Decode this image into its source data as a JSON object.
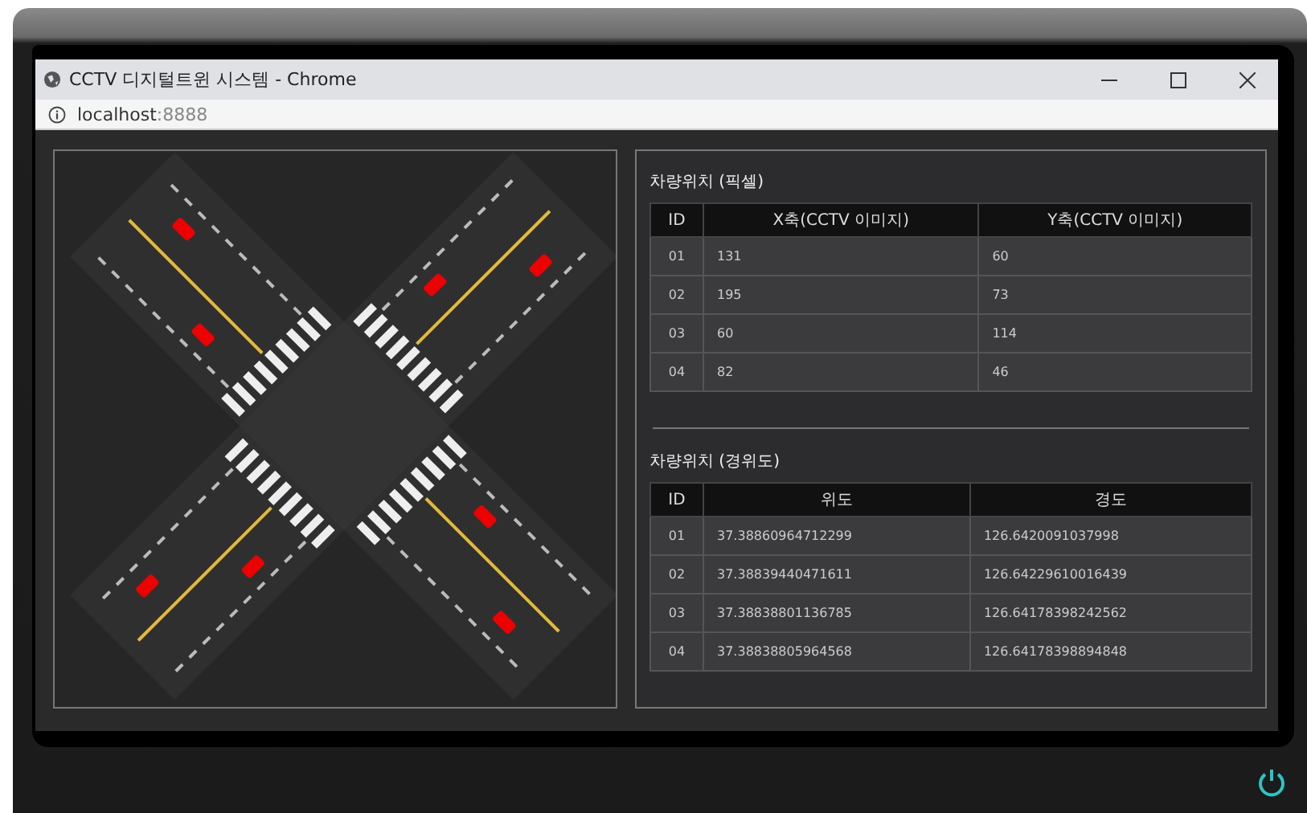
{
  "window": {
    "title": "CCTV 디지털트윈 시스템 - Chrome"
  },
  "address_bar": {
    "host": "localhost",
    "port": ":8888"
  },
  "pixel_table": {
    "title": "차량위치 (픽셀)",
    "columns": [
      "ID",
      "X축(CCTV 이미지)",
      "Y축(CCTV 이미지)"
    ],
    "rows": [
      [
        "01",
        "131",
        "60"
      ],
      [
        "02",
        "195",
        "73"
      ],
      [
        "03",
        "60",
        "114"
      ],
      [
        "04",
        "82",
        "46"
      ]
    ]
  },
  "geo_table": {
    "title": "차량위치 (경위도)",
    "columns": [
      "ID",
      "위도",
      "경도"
    ],
    "rows": [
      [
        "01",
        "37.38860964712299",
        "126.6420091037998"
      ],
      [
        "02",
        "37.38839440471611",
        "126.64229610016439"
      ],
      [
        "03",
        "37.38838801136785",
        "126.64178398242562"
      ],
      [
        "04",
        "37.38838805964568",
        "126.64178398894848"
      ]
    ]
  }
}
